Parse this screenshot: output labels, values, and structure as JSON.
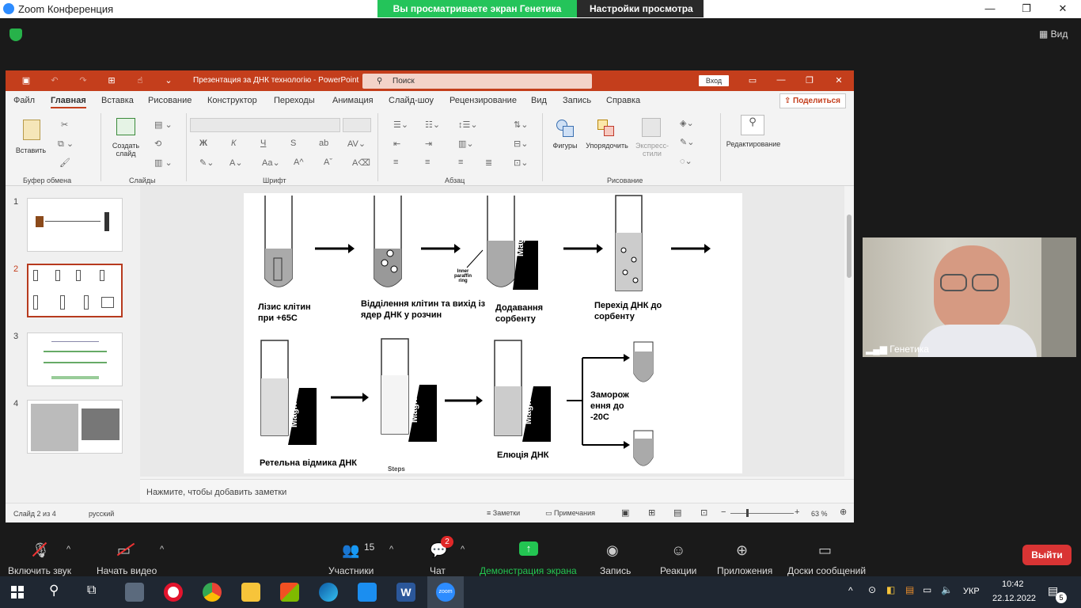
{
  "zoom": {
    "window_title": "Zoom Конференция",
    "share_banner": "Вы просматриваете экран Генетика",
    "view_settings": "Настройки просмотра ⌄",
    "view_button": "Вид",
    "participant_name": "Генетика",
    "toolbar": {
      "mute_label": "Включить звук",
      "video_label": "Начать видео",
      "participants_label": "Участники",
      "participants_count": "15",
      "chat_label": "Чат",
      "chat_badge": "2",
      "share_label": "Демонстрация экрана",
      "record_label": "Запись",
      "reactions_label": "Реакции",
      "apps_label": "Приложения",
      "whiteboards_label": "Доски сообщений",
      "leave_label": "Выйти"
    }
  },
  "ppt": {
    "doc_title": "Презентация за ДНК технологію  -  PowerPoint",
    "search_placeholder": "Поиск",
    "login": "Вход",
    "share": "Поделиться",
    "tabs": [
      "Файл",
      "Главная",
      "Вставка",
      "Рисование",
      "Конструктор",
      "Переходы",
      "Анимация",
      "Слайд-шоу",
      "Рецензирование",
      "Вид",
      "Запись",
      "Справка"
    ],
    "ribbon": {
      "paste": "Вставить",
      "clipboard_group": "Буфер обмена",
      "new_slide": "Создать слайд",
      "slides_group": "Слайды",
      "font_group": "Шрифт",
      "paragraph_group": "Абзац",
      "shapes": "Фигуры",
      "arrange": "Упорядочить",
      "quick_styles": "Экспресс-стили",
      "drawing_group": "Рисование",
      "editing": "Редактирование"
    },
    "thumbnails": [
      "1",
      "2",
      "3",
      "4"
    ],
    "notes_placeholder": "Нажмите, чтобы добавить заметки",
    "status": {
      "slide_info": "Слайд 2 из 4",
      "language": "русский",
      "notes": "Заметки",
      "comments": "Примечания",
      "zoom": "63 %"
    },
    "slide": {
      "step1": "Лізис клітин при +65С",
      "step2": "Відділення клітин та вихід із ядер ДНК у розчин",
      "step3": "Додавання сорбенту",
      "step4": "Перехід ДНК до сорбенту",
      "step5": "Ретельна відмика ДНК",
      "step6": "Елюція ДНК",
      "step7": "Заморож ення до -20С",
      "inner_label": "Inner paraffin ring",
      "magnet": "Magnet",
      "steps_cut": "Steps"
    }
  },
  "taskbar": {
    "lang": "УКР",
    "time": "10:42",
    "date": "22.12.2022",
    "notifications": "5"
  }
}
